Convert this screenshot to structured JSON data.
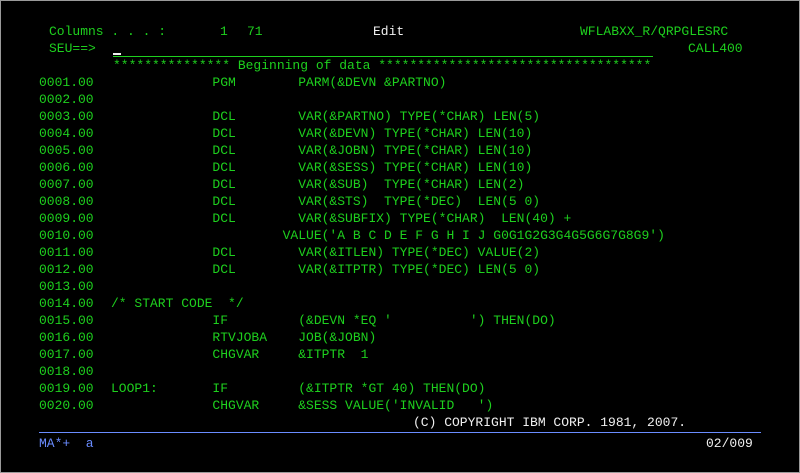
{
  "header": {
    "columns_label": "Columns . . . :",
    "columns_from": "1",
    "columns_to": "71",
    "mode": "Edit",
    "file": "WFLABXX_R/QRPGLESRC",
    "prompt": "SEU==>",
    "member": "CALL400"
  },
  "banner": "*************** Beginning of data ***********************************",
  "lines": [
    {
      "seq": "0001.00",
      "src": "             PGM        PARM(&DEVN &PARTNO)"
    },
    {
      "seq": "0002.00",
      "src": ""
    },
    {
      "seq": "0003.00",
      "src": "             DCL        VAR(&PARTNO) TYPE(*CHAR) LEN(5)"
    },
    {
      "seq": "0004.00",
      "src": "             DCL        VAR(&DEVN) TYPE(*CHAR) LEN(10)"
    },
    {
      "seq": "0005.00",
      "src": "             DCL        VAR(&JOBN) TYPE(*CHAR) LEN(10)"
    },
    {
      "seq": "0006.00",
      "src": "             DCL        VAR(&SESS) TYPE(*CHAR) LEN(10)"
    },
    {
      "seq": "0007.00",
      "src": "             DCL        VAR(&SUB)  TYPE(*CHAR) LEN(2)"
    },
    {
      "seq": "0008.00",
      "src": "             DCL        VAR(&STS)  TYPE(*DEC)  LEN(5 0)"
    },
    {
      "seq": "0009.00",
      "src": "             DCL        VAR(&SUBFIX) TYPE(*CHAR)  LEN(40) +"
    },
    {
      "seq": "0010.00",
      "src": "                      VALUE('A B C D E F G H I J G0G1G2G3G4G5G6G7G8G9')"
    },
    {
      "seq": "0011.00",
      "src": "             DCL        VAR(&ITLEN) TYPE(*DEC) VALUE(2)"
    },
    {
      "seq": "0012.00",
      "src": "             DCL        VAR(&ITPTR) TYPE(*DEC) LEN(5 0)"
    },
    {
      "seq": "0013.00",
      "src": ""
    },
    {
      "seq": "0014.00",
      "src": "/* START CODE  */"
    },
    {
      "seq": "0015.00",
      "src": "             IF         (&DEVN *EQ '          ') THEN(DO)"
    },
    {
      "seq": "0016.00",
      "src": "             RTVJOBA    JOB(&JOBN)"
    },
    {
      "seq": "0017.00",
      "src": "             CHGVAR     &ITPTR  1"
    },
    {
      "seq": "0018.00",
      "src": ""
    },
    {
      "seq": "0019.00",
      "src": "LOOP1:       IF         (&ITPTR *GT 40) THEN(DO)"
    },
    {
      "seq": "0020.00",
      "src": "             CHGVAR     &SESS VALUE('INVALID   ')"
    }
  ],
  "copyright": "(C) COPYRIGHT IBM CORP. 1981, 2007.",
  "status": {
    "left": "MA*+  a",
    "right": "02/009"
  }
}
